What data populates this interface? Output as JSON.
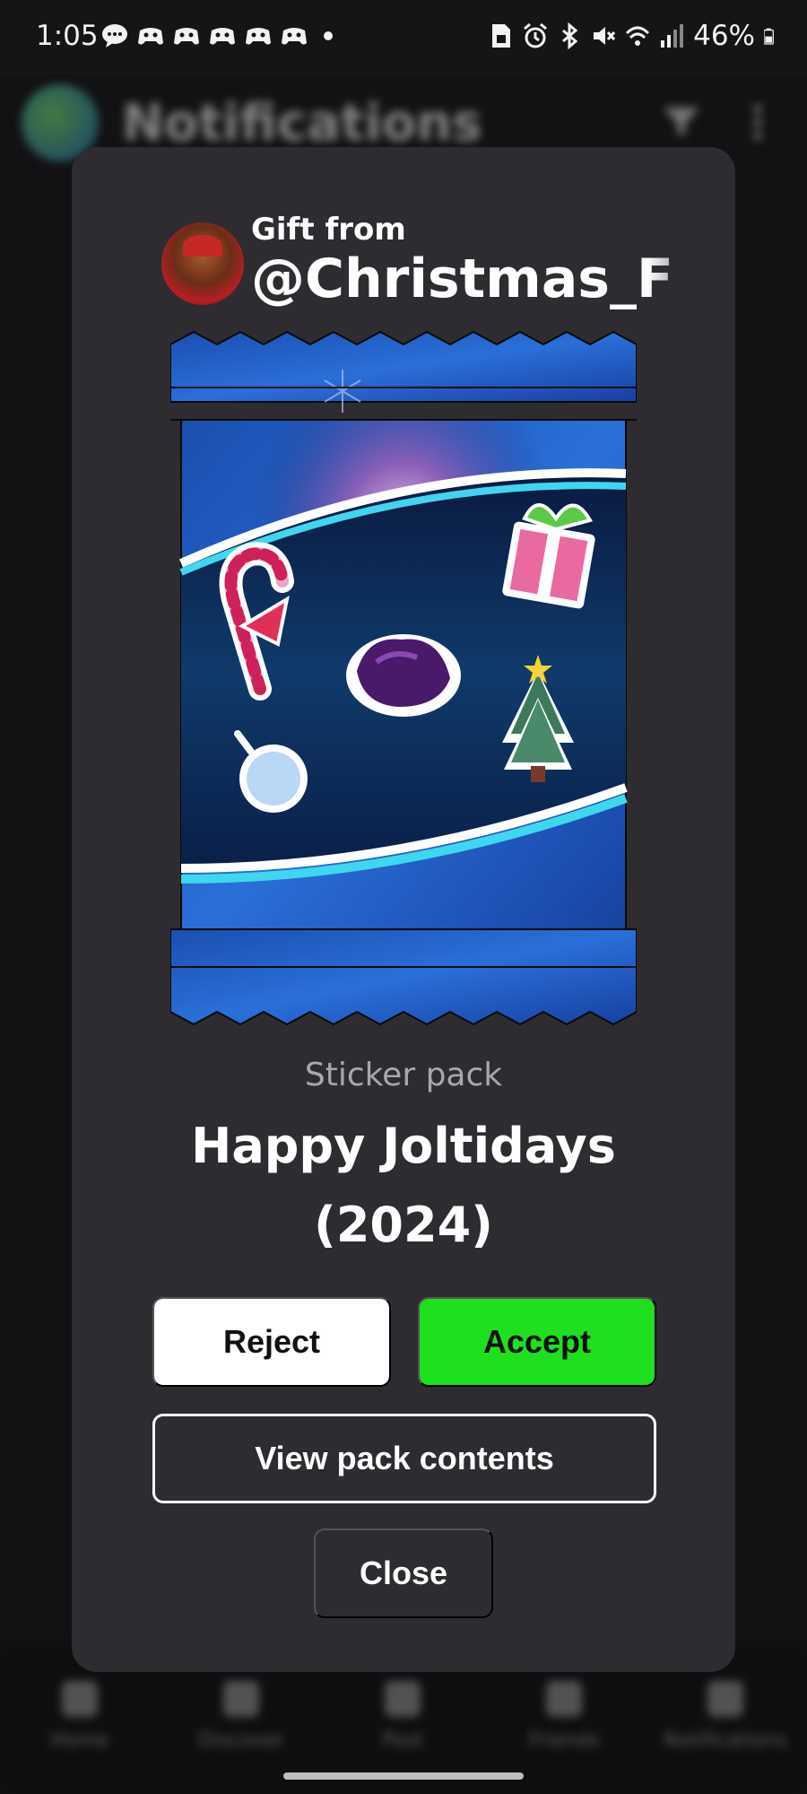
{
  "status_bar": {
    "time": "1:05",
    "battery": "46%",
    "left_icons": [
      "message-icon",
      "game-controller-icon",
      "game-controller-icon",
      "game-controller-icon",
      "game-controller-icon",
      "game-controller-icon",
      "dot-icon"
    ],
    "right_icons": [
      "sim-icon",
      "alarm-icon",
      "bluetooth-icon",
      "mute-icon",
      "wifi-icon",
      "signal-icon",
      "battery-icon"
    ]
  },
  "background": {
    "title": "Notifications",
    "nav": [
      {
        "label": "Home",
        "icon": "home-icon"
      },
      {
        "label": "Discover",
        "icon": "search-icon"
      },
      {
        "label": "Post",
        "icon": "plus-icon"
      },
      {
        "label": "Friends",
        "icon": "chat-icon"
      },
      {
        "label": "Notifications",
        "icon": "bell-icon"
      }
    ]
  },
  "modal": {
    "gift_label": "Gift from",
    "username": "@Christmas_F",
    "pack_type": "Sticker pack",
    "pack_name": "Happy Joltidays (2024)",
    "reject_label": "Reject",
    "accept_label": "Accept",
    "view_label": "View pack contents",
    "close_label": "Close"
  },
  "colors": {
    "modal_bg": "#2e2c30",
    "accept": "#1ee01e",
    "reject": "#ffffff",
    "pack_blue": "#1f5fc0",
    "pack_dark": "#0b1f4a",
    "accent_cyan": "#3fd6f0"
  }
}
